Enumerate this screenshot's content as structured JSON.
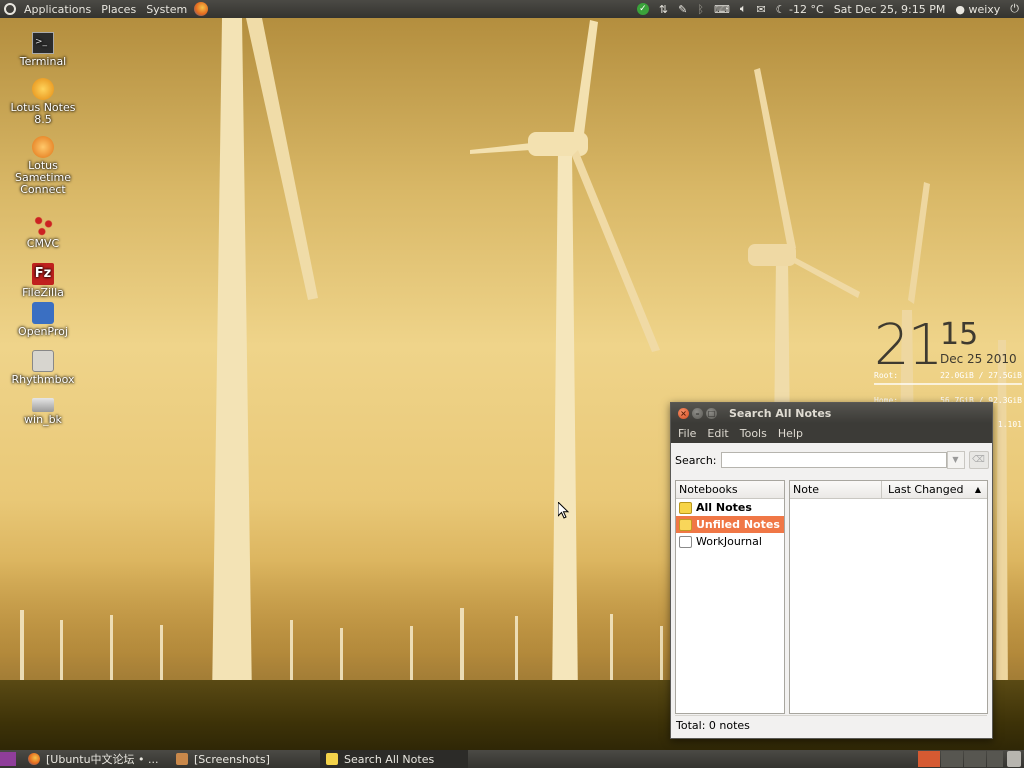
{
  "top_panel": {
    "menus": [
      "Applications",
      "Places",
      "System"
    ],
    "weather": "-12 °C",
    "datetime": "Sat Dec 25,  9:15 PM",
    "user": "weixy"
  },
  "desktop_icons": [
    {
      "label": "Terminal",
      "icon": "terminal-icon"
    },
    {
      "label": "Lotus Notes 8.5",
      "icon": "lotus-notes-icon"
    },
    {
      "label": "Lotus Sametime Connect",
      "icon": "sametime-icon"
    },
    {
      "label": "CMVC",
      "icon": "cmvc-icon"
    },
    {
      "label": "FileZilla",
      "icon": "filezilla-icon"
    },
    {
      "label": "OpenProj",
      "icon": "openproj-icon"
    },
    {
      "label": "Rhythmbox",
      "icon": "rhythmbox-icon"
    },
    {
      "label": "win_bk",
      "icon": "drive-icon"
    }
  ],
  "clock_widget": {
    "hour": "21",
    "minute": "15",
    "date": "Dec 25 2010",
    "rows": [
      {
        "label": "Root:",
        "value": "22.0GiB / 27.5GiB"
      },
      {
        "label": "Home:",
        "value": "56.7GiB / 92.3GiB"
      }
    ],
    "ip_fragment": "1.101"
  },
  "window": {
    "title": "Search All Notes",
    "menu": [
      "File",
      "Edit",
      "Tools",
      "Help"
    ],
    "search_label": "Search:",
    "search_value": "",
    "notebooks_header": "Notebooks",
    "notebooks": [
      {
        "label": "All Notes",
        "style": "bold",
        "icon": "all-notes-icon"
      },
      {
        "label": "Unfiled Notes",
        "style": "selected",
        "icon": "unfiled-notes-icon"
      },
      {
        "label": "WorkJournal",
        "style": "normal",
        "icon": "notebook-icon"
      }
    ],
    "columns": {
      "note": "Note",
      "last_changed": "Last Changed"
    },
    "status": "Total: 0 notes"
  },
  "taskbar": [
    {
      "label": "[Ubuntu中文论坛 • ...",
      "icon": "firefox-icon",
      "active": false
    },
    {
      "label": "[Screenshots]",
      "icon": "folder-icon",
      "active": false
    },
    {
      "label": "Search All Notes",
      "icon": "tomboy-icon",
      "active": true
    }
  ],
  "colors": {
    "accent_selected": "#f07746",
    "panel": "#3c3b37"
  }
}
